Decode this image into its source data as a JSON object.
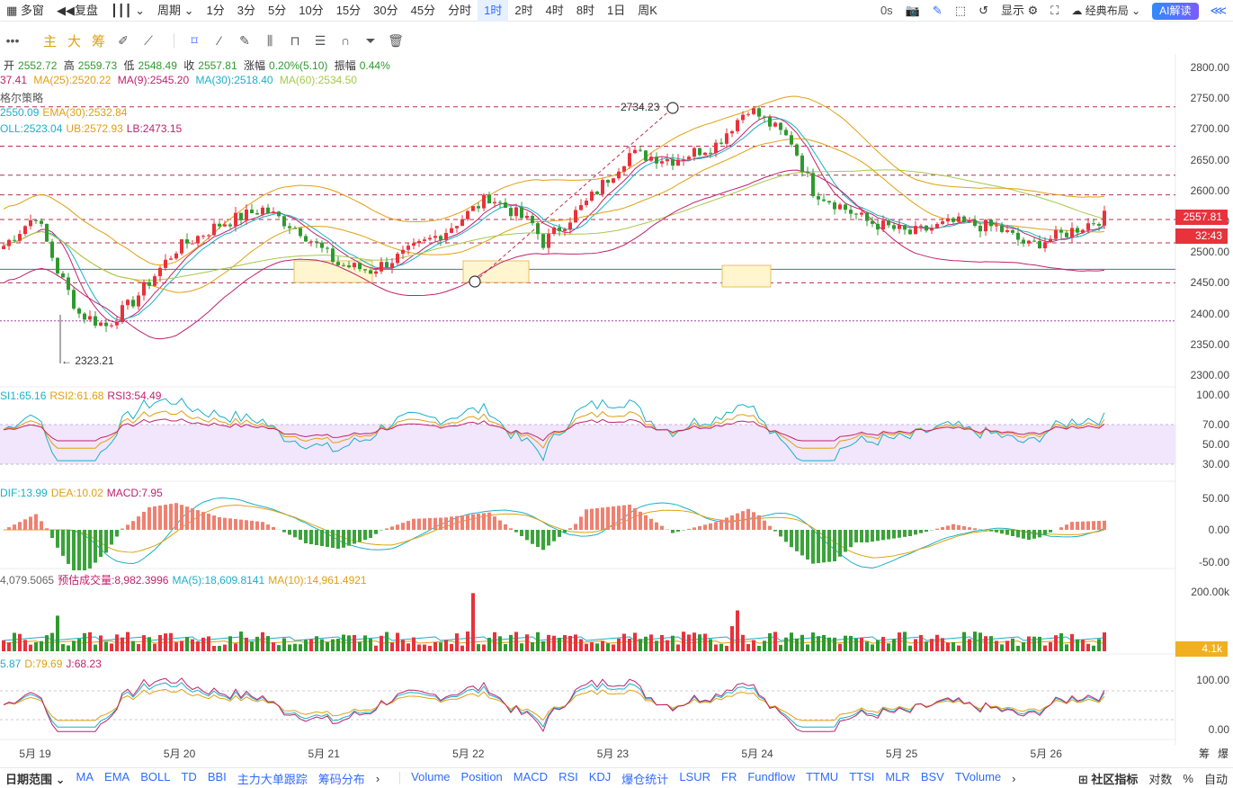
{
  "toolbar": {
    "multi_window": "多窗",
    "replay": "复盘",
    "period": "周期",
    "periods": [
      "1分",
      "3分",
      "5分",
      "10分",
      "15分",
      "30分",
      "45分",
      "分时",
      "1时",
      "2时",
      "4时",
      "8时",
      "1日",
      "周K"
    ],
    "active_period": "1时",
    "latency": "0s",
    "display": "显示",
    "layout": "经典布局",
    "ai": "AI解读"
  },
  "draw_tools": {
    "main": "主",
    "big": "大",
    "chip": "筹"
  },
  "legends": {
    "ohlc": {
      "open_l": "开",
      "open": "2552.72",
      "high_l": "高",
      "high": "2559.73",
      "low_l": "低",
      "low": "2548.49",
      "close_l": "收",
      "close": "2557.81",
      "chg_l": "涨幅",
      "chg": "0.20%(5.10)",
      "amp_l": "振幅",
      "amp": "0.44%"
    },
    "ma": {
      "ma7": "37.41",
      "ma25": "MA(25):2520.22",
      "ma9": "MA(9):2545.20",
      "ma30": "MA(30):2518.40",
      "ma60": "MA(60):2534.50"
    },
    "strategy": "格尔策略",
    "ema": {
      "e1": "2550.09",
      "e2": "EMA(30):2532.84"
    },
    "boll": {
      "mid": "OLL:2523.04",
      "ub": "UB:2572.93",
      "lb": "LB:2473.15"
    },
    "rsi": {
      "r1": "SI1:65.16",
      "r2": "RSI2:61.68",
      "r3": "RSI3:54.49"
    },
    "macd": {
      "dif": "DIF:13.99",
      "dea": "DEA:10.02",
      "macd": "MACD:7.95"
    },
    "vol": {
      "v": "4,079.5065",
      "est": "预估成交量:8,982.3996",
      "ma5": "MA(5):18,609.8141",
      "ma10": "MA(10):14,961.4921"
    },
    "kdj": {
      "k": "5.87",
      "d": "D:79.69",
      "j": "J:68.23"
    }
  },
  "price_axis": [
    "2800.00",
    "2750.00",
    "2700.00",
    "2650.00",
    "2600.00",
    "2550.00",
    "2500.00",
    "2450.00",
    "2400.00",
    "2350.00",
    "2300.00"
  ],
  "rsi_axis": [
    "100.00",
    "70.00",
    "50.00",
    "30.00"
  ],
  "macd_axis": [
    "50.00",
    "0.00",
    "-50.00"
  ],
  "vol_axis": [
    "200.00k"
  ],
  "kdj_axis": [
    "100.00",
    "0.00"
  ],
  "price_tag": "2557.81",
  "countdown": "32:43",
  "vol_tag": "4.1k",
  "annotations": {
    "high": "2734.23",
    "low": "← 2323.21"
  },
  "x_labels": [
    "5月 19",
    "5月 20",
    "5月 21",
    "5月 22",
    "5月 23",
    "5月 24",
    "5月 25",
    "5月 26"
  ],
  "x_right": {
    "a": "筹",
    "b": "爆"
  },
  "bottom": {
    "range": "日期范围",
    "left": [
      "MA",
      "EMA",
      "BOLL",
      "TD",
      "BBI",
      "主力大单跟踪",
      "筹码分布"
    ],
    "right": [
      "Volume",
      "Position",
      "MACD",
      "RSI",
      "KDJ",
      "爆仓统计",
      "LSUR",
      "FR",
      "Fundflow",
      "TTMU",
      "TTSI",
      "MLR",
      "BSV",
      "TVolume"
    ],
    "community": "社区指标",
    "log": "对数",
    "pct": "%",
    "auto": "自动"
  },
  "colors": {
    "up": "#e8323c",
    "down": "#2e9a2e",
    "accent": "#2f6bff"
  }
}
